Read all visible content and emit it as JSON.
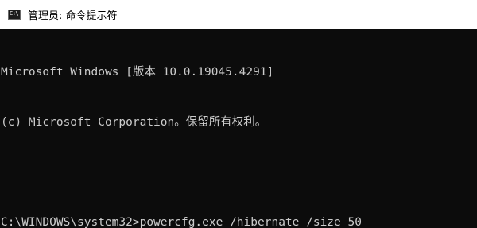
{
  "window": {
    "title": "管理员: 命令提示符",
    "icon": "cmd-icon",
    "icon_glyph": "C:\\"
  },
  "console": {
    "lines": [
      "Microsoft Windows [版本 10.0.19045.4291]",
      "(c) Microsoft Corporation。保留所有权利。",
      "",
      "C:\\WINDOWS\\system32>powercfg.exe /hibernate /size 50"
    ]
  },
  "colors": {
    "console_background": "#0c0c0c",
    "console_text": "#cccccc",
    "titlebar_background": "#ffffff",
    "title_text": "#000000"
  }
}
